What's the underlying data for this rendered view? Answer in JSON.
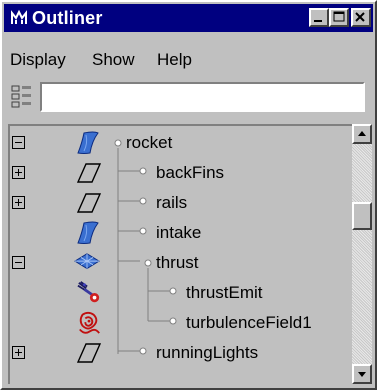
{
  "window": {
    "title": "Outliner",
    "app_icon": "maya-icon",
    "buttons": [
      "minimize-icon",
      "maximize-icon",
      "close-icon"
    ]
  },
  "menubar": {
    "items": [
      "Display",
      "Show",
      "Help"
    ]
  },
  "filter": {
    "value": "",
    "icon": "outliner-layout-icon"
  },
  "tree": {
    "items": [
      {
        "label": "rocket",
        "icon": "nurbs-surface-icon",
        "expander": "minus",
        "depth": 0
      },
      {
        "label": "backFins",
        "icon": "plane-outline-icon",
        "expander": "plus",
        "depth": 1
      },
      {
        "label": "rails",
        "icon": "plane-outline-icon",
        "expander": "plus",
        "depth": 1
      },
      {
        "label": "intake",
        "icon": "nurbs-surface-icon",
        "expander": "none",
        "depth": 1
      },
      {
        "label": "thrust",
        "icon": "poly-mesh-icon",
        "expander": "minus",
        "depth": 1
      },
      {
        "label": "thrustEmit",
        "icon": "emitter-icon",
        "expander": "none",
        "depth": 2
      },
      {
        "label": "turbulenceField1",
        "icon": "turbulence-field-icon",
        "expander": "none",
        "depth": 2
      },
      {
        "label": "runningLights",
        "icon": "plane-outline-icon",
        "expander": "plus",
        "depth": 1
      }
    ]
  },
  "colors": {
    "titlebar": "#000080",
    "window_bg": "#c0c0c0",
    "nurbs_blue": "#2b5fbf"
  }
}
